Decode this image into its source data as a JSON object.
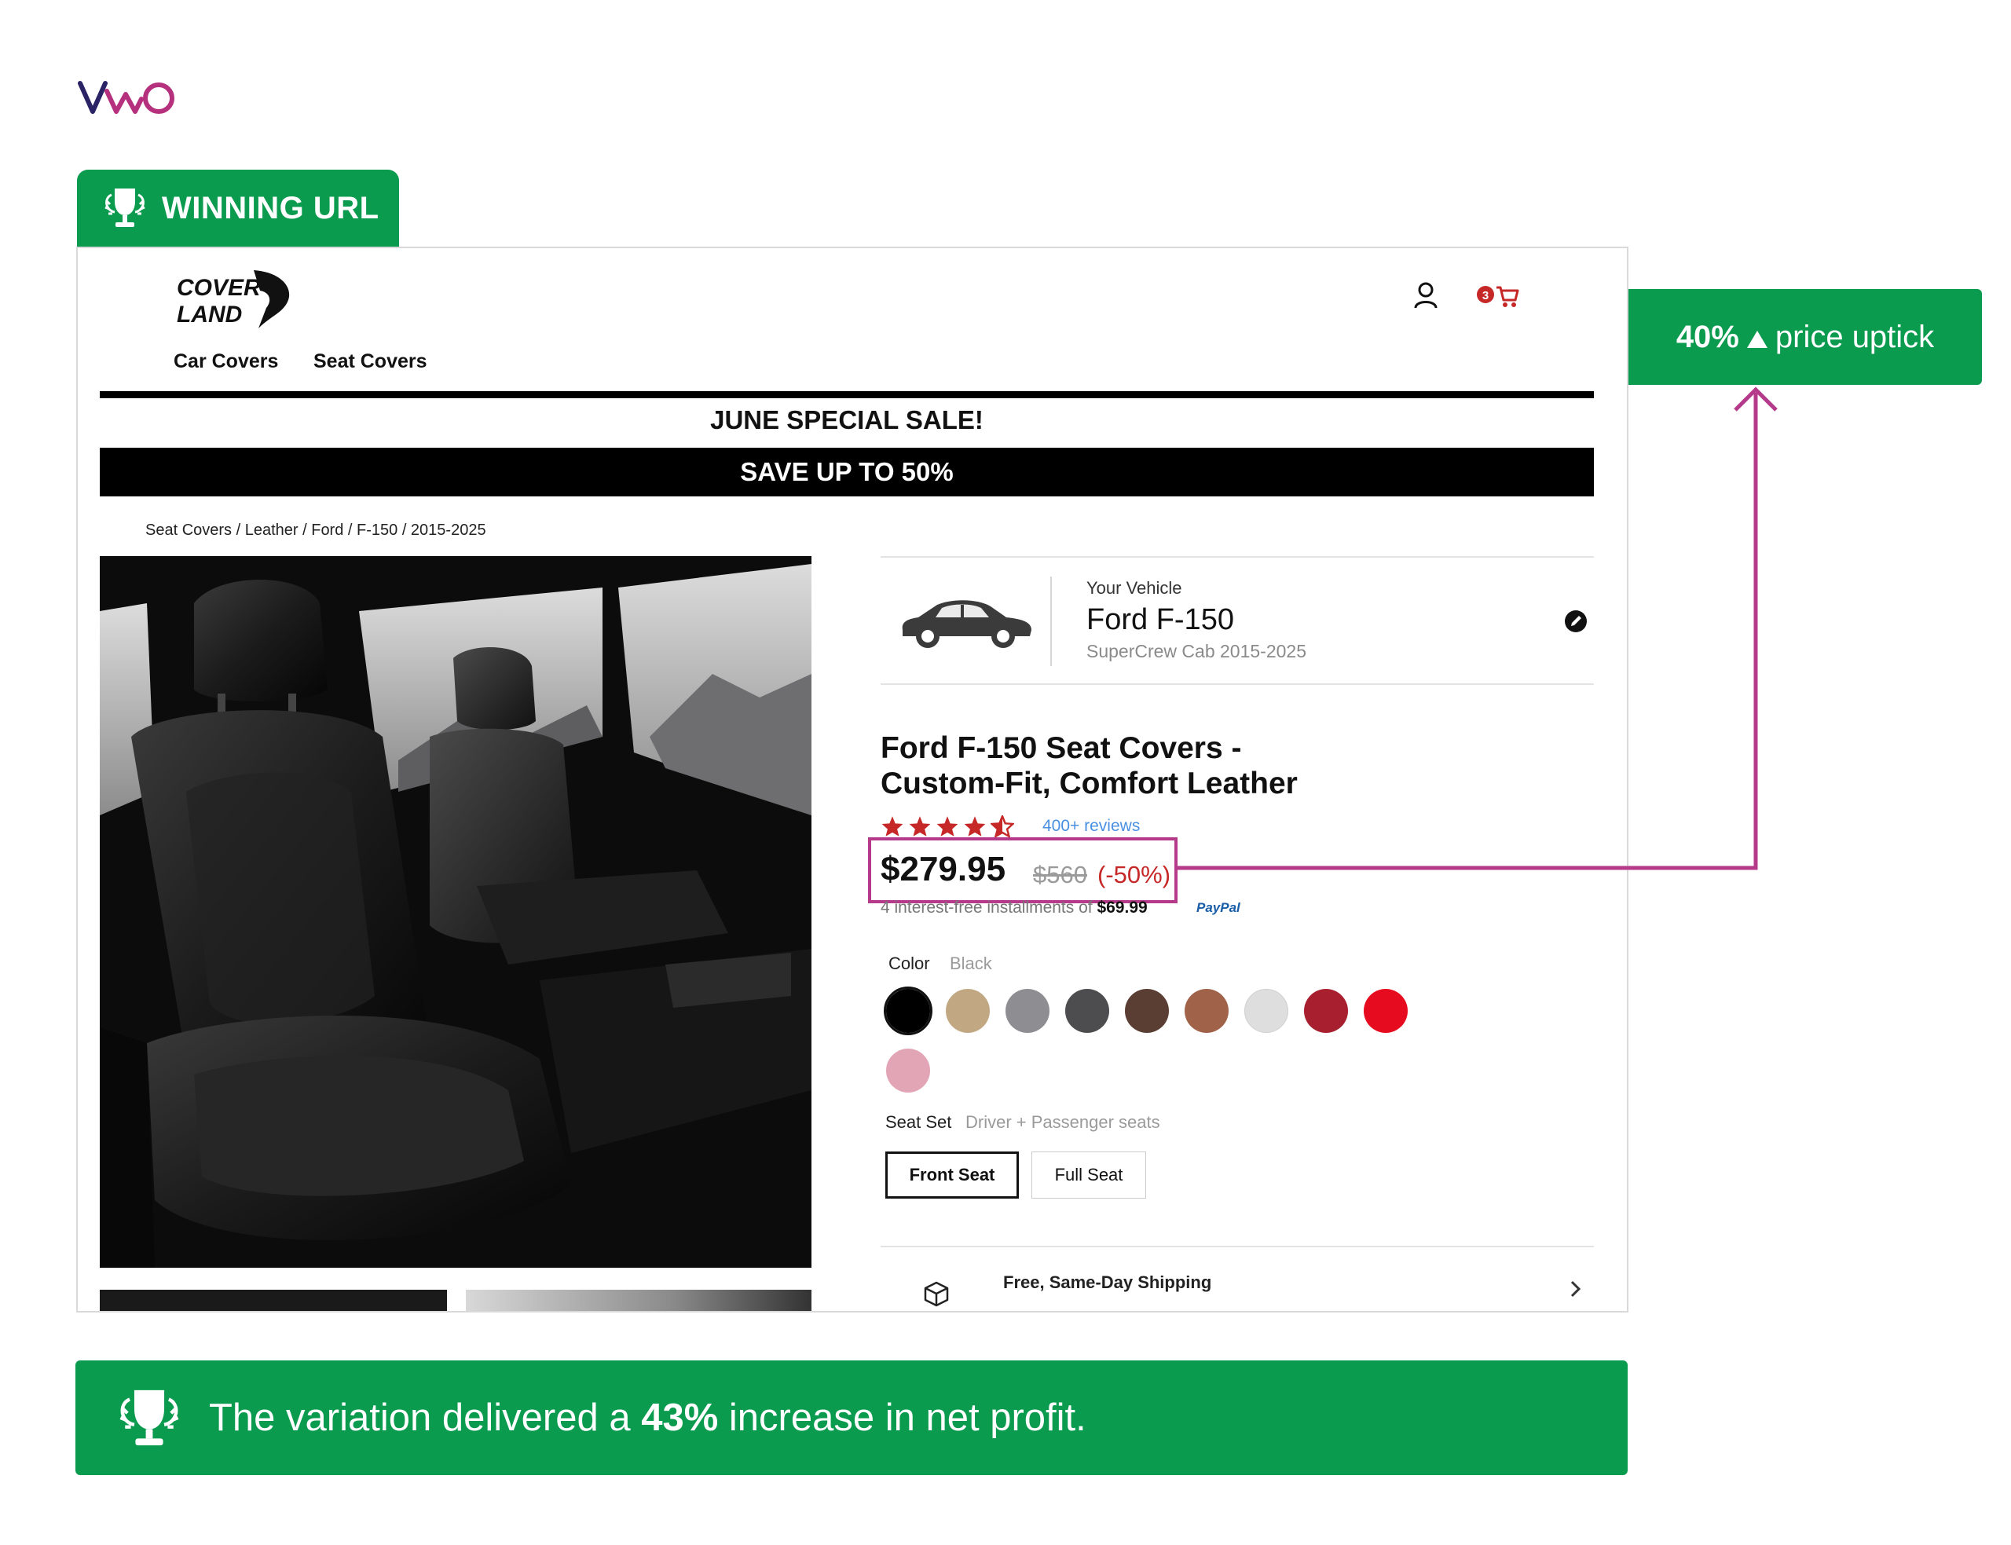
{
  "brand": {
    "logo_text": "VWO"
  },
  "winning_tag": {
    "label": "WINNING URL"
  },
  "site": {
    "logo_line1": "COVER",
    "logo_line2": "LAND",
    "nav": [
      "Car Covers",
      "Seat Covers"
    ],
    "cart_count": "3",
    "sale_title": "JUNE SPECIAL SALE!",
    "sale_bar": "SAVE UP TO 50%",
    "breadcrumb": "Seat Covers / Leather / Ford / F-150 / 2015-2025",
    "vehicle": {
      "eyebrow": "Your Vehicle",
      "name": "Ford F-150",
      "sub": "SuperCrew Cab 2015-2025"
    },
    "product": {
      "title_line1": "Ford F-150 Seat Covers -",
      "title_line2": "Custom-Fit, Comfort Leather",
      "rating": 4.5,
      "reviews": "400+ reviews",
      "price": "$279.95",
      "price_old": "$560",
      "price_off": "(-50%)",
      "installments_prefix": "4 interest-free installments of ",
      "installments_amount": "$69.99",
      "paypal": "PayPal"
    },
    "color": {
      "label": "Color",
      "value": "Black",
      "swatches": [
        "#000000",
        "#c2a882",
        "#8e8e92",
        "#4d4d4f",
        "#5a3e34",
        "#a0634a",
        "#dddedd",
        "#a8202f",
        "#e60b1f",
        "#e1a5b5"
      ],
      "selected_index": 0
    },
    "seat_set": {
      "label": "Seat Set",
      "value": "Driver + Passenger seats",
      "options": [
        "Front Seat",
        "Full Seat"
      ],
      "selected_index": 0
    },
    "shipping": {
      "label": "Free, Same-Day Shipping"
    }
  },
  "callout": {
    "percent": "40%",
    "label": "price uptick"
  },
  "result": {
    "prefix": "The variation delivered a ",
    "highlight": "43%",
    "suffix": " increase in net profit."
  },
  "colors": {
    "accent_green": "#0b9b4f",
    "highlight_magenta": "#b53a8a",
    "discount_red": "#c62828",
    "review_blue": "#4a90e2"
  }
}
